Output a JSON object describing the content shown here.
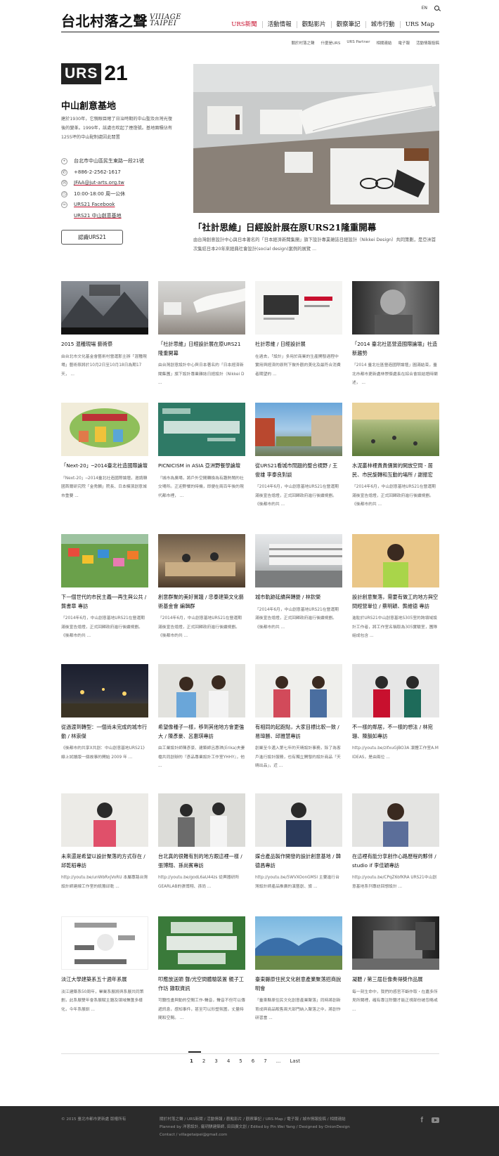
{
  "header": {
    "site_title_zh": "台北村落之聲",
    "site_title_en_line1": "VIIIAGE",
    "site_title_en_line2": "TAIPEI",
    "lang": "EN",
    "nav": [
      {
        "label": "URS新聞",
        "active": true
      },
      {
        "label": "活動情報"
      },
      {
        "label": "觀點影片"
      },
      {
        "label": "觀察筆記"
      },
      {
        "label": "城市行動"
      },
      {
        "label": "URS Map"
      }
    ],
    "subnav": [
      "關於村落之聲",
      "什麼是URS",
      "URS Partner",
      "相關連結",
      "電子報",
      "活動情報投稿"
    ]
  },
  "feature": {
    "logo_box": "URS",
    "logo_num": "21",
    "place_title": "中山創意基地",
    "place_desc": "建於1930年，它親眼目睹了日治時期的中山聖及台灣光復後的變革。1999年，該處也吹起了煙燈號。基地面積佔有1255坪的中山配制處因此閒置",
    "info": [
      {
        "icon": "map-pin-icon",
        "text": "台北市中山區民生東路一段21號"
      },
      {
        "icon": "phone-icon",
        "text": "+886-2-2562-1617"
      },
      {
        "icon": "mail-icon",
        "text": "JFAA@jut-arts.org.tw"
      },
      {
        "icon": "clock-icon",
        "text": "10:00-18:00 周一公休"
      },
      {
        "icon": "link-icon",
        "text": "URS21 Facebook"
      },
      {
        "icon": "",
        "text": "URS21 中山創意基地"
      }
    ],
    "button": "認識URS21",
    "hero_title": "「社計思維」日經設計展在原URS21隆重開幕",
    "hero_desc": "由台灣創意設計中心與日本著名的「日本經濟新聞集團」旗下設計專業雜誌日經設計（Nikkei Design）共同策劃，是亞洲首次集結日本20年來經典社會設計(social design)案例的展覽 ..."
  },
  "articles": [
    {
      "title": "2015 混種現場 藝術祭",
      "desc": "由台北市文化基金會藝術村營運那主辦「混種現場」藝術祭將於10月2日至10月18日為期17天， ..."
    },
    {
      "title": "「社計思維」日經設計展在原URS21隆重開幕",
      "desc": "由台灣創意設計中心與日本著名的「日本經濟新聞集團」旗下設計專業雜誌日經設計（Nikkei D ..."
    },
    {
      "title": "社計思維 / 日經設計展",
      "desc": "在過去，「設計」多用於商業的生產開發過程中實用與經濟的原則下做外觀的美化及最符合消費者期望的 ..."
    },
    {
      "title": "「2014 臺北社區營造國際論壇」社造新趨勢",
      "desc": "「2014 臺北社區營造國際論壇」圓滿結束，臺北市都市更新處林崇傑處長在綜合會談結語時闡述， ..."
    },
    {
      "title": "「Next-20」─2014臺北社造國際論壇",
      "desc": "「Next-20」─2014臺北社造國際論壇，邀請韓國首爾研究院「金秀麟」院長、日本橫濱創意城市重要 ..."
    },
    {
      "title": "PICNICISM in ASIA 亞洲野餐學論壇",
      "desc": "「城市為廣場，將戶外空間轉換為有趣熱鬧的社交場所。正迎野餐的時機，即便在兩百年後的現代都市裡， ..."
    },
    {
      "title": "從URS21看城市問題的整合視野 / 王俊雄 李泰良對談",
      "desc": "「2014年6月，中山創意基地URS21在營運期滿後宣告熄燈，正式回歸政府進行後續規劃。《後都市的共 ..."
    },
    {
      "title": "水泥叢林裡貴貴價實的開放空間 - 居民、市民旋轉和互動的場所 / 謝振宏",
      "desc": "「2014年6月，中山創意基地URS21在營運期滿後宣告熄燈，正式回歸政府進行後續規劃。《後都市的共 ..."
    },
    {
      "title": "下一個世代的市民主義──再生與公共 / 龔書章 專訪",
      "desc": "「2014年6月，中山創意基地URS21在營運期滿後宣告熄燈，正式回歸政府進行後續規劃。《後都市的共 ..."
    },
    {
      "title": "創意群聚的美好實踐 / 忠泰建築文化藝術基金會 編輯群",
      "desc": "「2014年6月，中山創意基地URS21在營運期滿後宣告熄燈，正式回歸政府進行後續規劃。《後都市的共 ..."
    },
    {
      "title": "城市軌跡延續與轉變 / 林欽榮",
      "desc": "「2014年6月，中山創意基地URS21在營運期滿後宣告熄燈，正式回歸政府進行後續規劃。《後都市的共 ..."
    },
    {
      "title": "設計創意聚落，需要有做工的地方與空間經營單位 / 蔡明穎、龔維德 專訪",
      "desc": "進駐於URS21中山創意基地S305室的跨領域設計工作者，將工作室名稱取為305實驗室，團隊組成包含 ..."
    },
    {
      "title": "從過渡到轉型：一個尚未完成的城市行動 / 林崇傑",
      "desc": "《後都市的共享X共創：中山創意基地URS21》線上試讀版一個故事的開始 2009 年 ..."
    },
    {
      "title": "希望像種子一樣，移到其他地方會更強大 / 陳彥豪、呂惠琪專訪",
      "desc": "由工業設計師陳彥豪、建築師呂惠琪(Erika)夫妻檔共同創辦的『彥品專業設計工作室YHHY』，他 ..."
    },
    {
      "title": "有相同的起跑點，大家目標比較一致 / 易瑋勝、邱雅慧專訪",
      "desc": "創業至今邁入第七年的天晴設計事務，除了為客戶進行設計服務，也有獨立開發的設計商品「天晴出品」，近 ..."
    },
    {
      "title": "不一樣的鄰居，不一樣的想法 / 林宛珊、陳韻如專訪",
      "desc": "http://youtu.be/zifxuGjBO3A 凜體工作室A.M IDEAS，是由兩位 ..."
    },
    {
      "title": "未來還是希望以設計聚落的方式存在 / 邱乾稻專訪",
      "desc": "http://youtu.be/unWbRxjVoRU 本屬專路台灣設計師建線工作室的統籌邱乾 ..."
    },
    {
      "title": "台北真的很難有別的地方跟這裡一樣 / 張博翔、孫尚賓專訪",
      "desc": "http://youtu.be/godL6aU44zs 從興器研所GEARLAB的張博翔、孫尚 ..."
    },
    {
      "title": "媒合產品製作開發的設計創意基地 / 韓德昌專訪",
      "desc": "http://youtu.be/5WVXOonGMSI 主要進行台灣設計師產品推廣的漢藝創、旗 ..."
    },
    {
      "title": "在這裡有能分享創作心路歷程的夥伴 / studio if 李佳穎專訪",
      "desc": "http://youtu.be/CPqZ6bfKRA URS21中山創意基地系列專訪回想設計 ..."
    },
    {
      "title": "淡江大學建築系五十週年系展",
      "desc": "淡江建築系50周年，畢業系展將與系展共同策劃，此系展雙年會系展賦主題及領域兼匯多樣化，今年系展訓 ..."
    },
    {
      "title": "叩應放送頭 聲/光空間體驗裝置 親子工作坊 錄取資訊",
      "desc": "可聽性畫與動的空間工作-聲音，聲音不但可以傳遞訊息，感知事件，甚至可以形塑氛圍，丈量時間和空間。 ..."
    },
    {
      "title": "臺東縣原住民文化創意產業聚落招商說明會",
      "desc": "「臺東縣原住民文化創意產業聚落」同時將創新育成與商品販售兩大部門納入聚落之中，將創作研習當 ..."
    },
    {
      "title": "凝聽 / 第三屆巨像奏得獎作品展",
      "desc": "每一刻生命中，我們的感官不斷作取・在嘉多所見所聞裡，確有專注聆聽才能正視部份被忽略或 ..."
    }
  ],
  "pager": {
    "pages": [
      "1",
      "2",
      "3",
      "4",
      "5",
      "6",
      "7",
      "...",
      "Last"
    ]
  },
  "footer": {
    "copyright": "© 2015 臺北市都市更新處 版權所有",
    "links_line": "關於村落之聲 / URS新聞 / 活動情報 / 觀點影片 / 觀察筆記 / URS Map / 電子報 / 城市情報投稿 / 相關連結",
    "credits": "Planned by 洋蔥設計, 龐玥騏建築師, 田田廣文創 / Edited by Pin Wei Yang / Designed by OnionDesign",
    "contact": "Contact / villagetaipei@gmail.com"
  },
  "colors": {
    "accent": "#c8102e",
    "footer_bg": "#2b2b2b"
  }
}
